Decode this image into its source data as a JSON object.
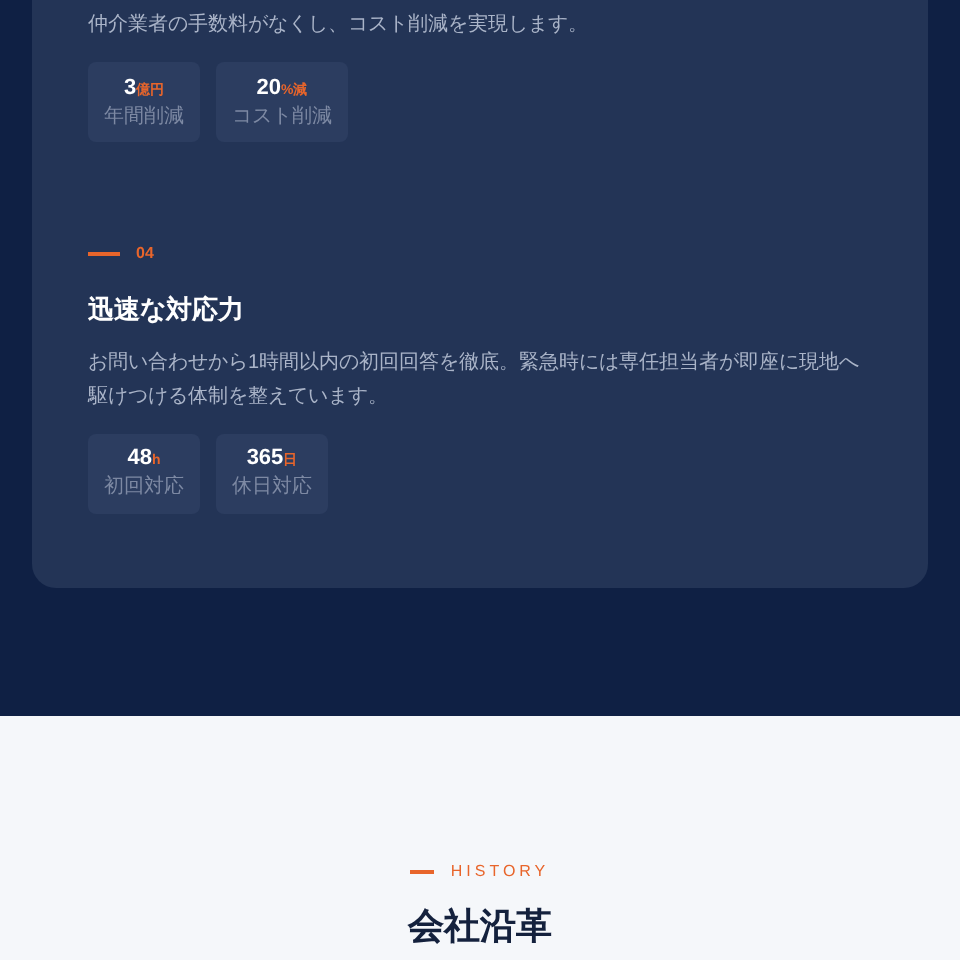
{
  "features": [
    {
      "description": "仲介業者の手数料がなくし、コスト削減を実現します。",
      "stats": [
        {
          "value": "3",
          "unit": "億円",
          "label": "年間削減"
        },
        {
          "value": "20",
          "unit": "%減",
          "label": "コスト削減"
        }
      ]
    },
    {
      "number": "04",
      "title": "迅速な対応力",
      "description": "お問い合わせから1時間以内の初回回答を徹底。緊急時には専任担当者が即座に現地へ駆けつける体制を整えています。",
      "stats": [
        {
          "value": "48",
          "unit": "h",
          "label": "初回対応"
        },
        {
          "value": "365",
          "unit": "日",
          "label": "休日対応"
        }
      ]
    }
  ],
  "history": {
    "eyebrow": "HISTORY",
    "title": "会社沿革"
  }
}
